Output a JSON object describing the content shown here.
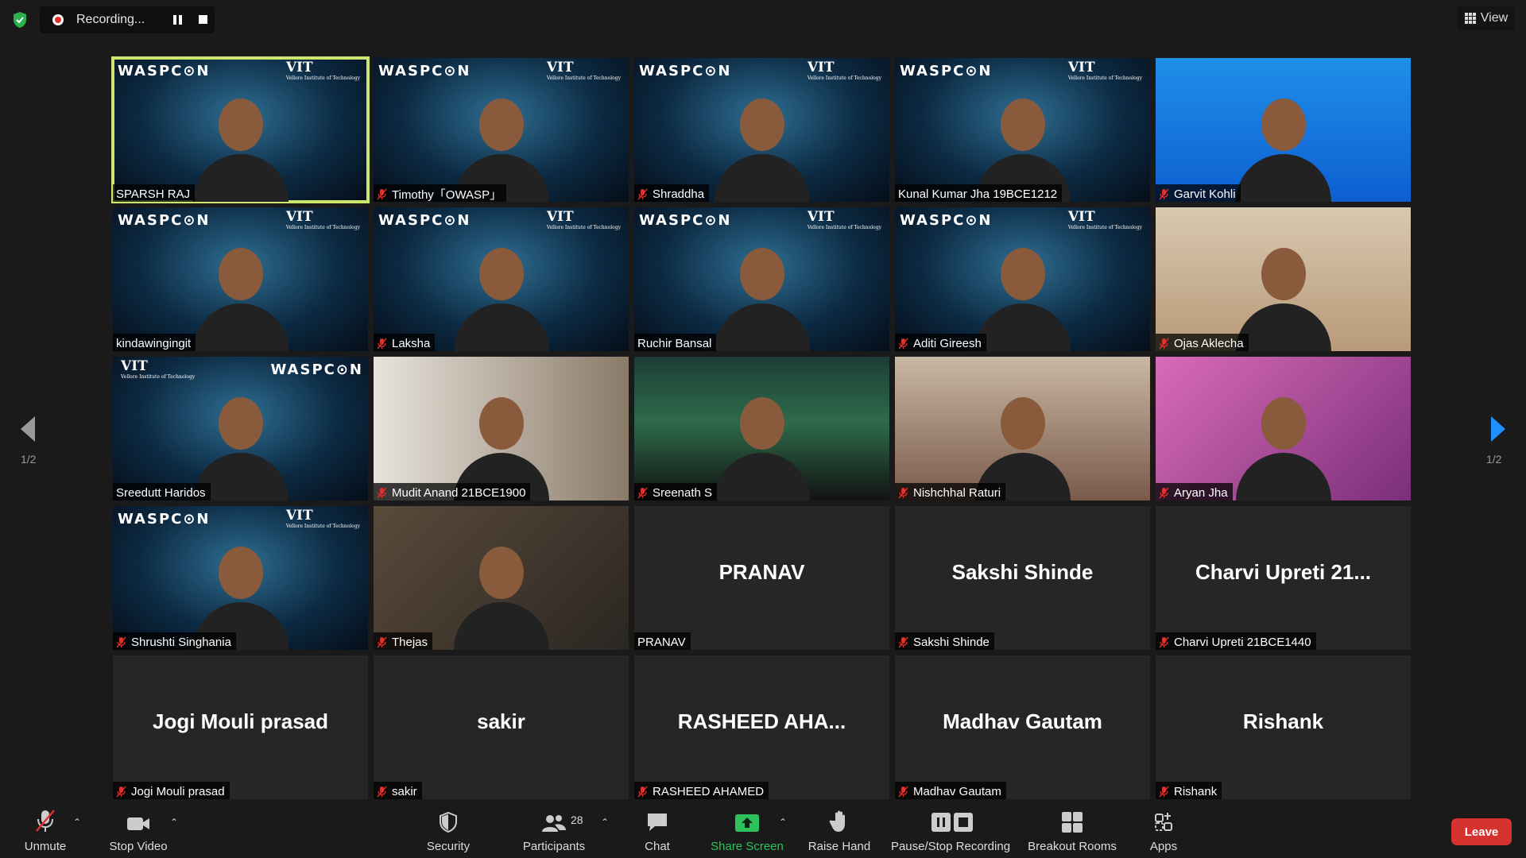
{
  "topbar": {
    "recording_label": "Recording...",
    "view_label": "View"
  },
  "gallery": {
    "page_left": "1/2",
    "page_right": "1/2"
  },
  "participants": [
    {
      "name": "SPARSH RAJ",
      "video": true,
      "muted": false,
      "active": true,
      "bg": "waspcon"
    },
    {
      "name": "Timothy「OWASP」",
      "video": true,
      "muted": true,
      "bg": "waspcon"
    },
    {
      "name": "Shraddha",
      "video": true,
      "muted": true,
      "bg": "waspcon"
    },
    {
      "name": "Kunal Kumar Jha 19BCE1212",
      "video": true,
      "muted": false,
      "bg": "waspcon"
    },
    {
      "name": "Garvit Kohli",
      "video": true,
      "muted": true,
      "bg": "blue"
    },
    {
      "name": "kindawingingit",
      "video": true,
      "muted": false,
      "bg": "waspcon"
    },
    {
      "name": "Laksha",
      "video": true,
      "muted": true,
      "bg": "waspcon"
    },
    {
      "name": "Ruchir Bansal",
      "video": true,
      "muted": false,
      "bg": "waspcon"
    },
    {
      "name": "Aditi Gireesh",
      "video": true,
      "muted": true,
      "bg": "waspcon"
    },
    {
      "name": "Ojas Aklecha",
      "video": true,
      "muted": true,
      "bg": "doge"
    },
    {
      "name": "Sreedutt Haridos",
      "video": true,
      "muted": false,
      "bg": "waspcon-mirrored"
    },
    {
      "name": "Mudit Anand 21BCE1900",
      "video": true,
      "muted": true,
      "bg": "light"
    },
    {
      "name": "Sreenath S",
      "video": true,
      "muted": true,
      "bg": "aurora"
    },
    {
      "name": "Nishchhal Raturi",
      "video": true,
      "muted": true,
      "bg": "room"
    },
    {
      "name": "Aryan Jha",
      "video": true,
      "muted": true,
      "bg": "pink"
    },
    {
      "name": "Shrushti Singhania",
      "video": true,
      "muted": true,
      "bg": "waspcon"
    },
    {
      "name": "Thejas",
      "video": true,
      "muted": true,
      "bg": "plain"
    },
    {
      "name": "PRANAV",
      "video": false,
      "muted": false,
      "display": "PRANAV"
    },
    {
      "name": "Sakshi Shinde",
      "video": false,
      "muted": true,
      "display": "Sakshi Shinde"
    },
    {
      "name": "Charvi Upreti 21BCE1440",
      "video": false,
      "muted": true,
      "display": "Charvi  Upreti  21..."
    },
    {
      "name": "Jogi Mouli prasad",
      "video": false,
      "muted": true,
      "display": "Jogi Mouli prasad"
    },
    {
      "name": "sakir",
      "video": false,
      "muted": true,
      "display": "sakir"
    },
    {
      "name": "RASHEED AHAMED",
      "video": false,
      "muted": true,
      "display": "RASHEED  AHA..."
    },
    {
      "name": "Madhav Gautam",
      "video": false,
      "muted": true,
      "display": "Madhav Gautam"
    },
    {
      "name": "Rishank",
      "video": false,
      "muted": true,
      "display": "Rishank"
    }
  ],
  "background": {
    "waspcon_text": "WASPC⊙N",
    "vit_text": "VIT",
    "vit_sub": "Vellore Institute of Technology"
  },
  "toolbar": {
    "unmute": "Unmute",
    "stop_video": "Stop Video",
    "security": "Security",
    "participants": "Participants",
    "participants_count": "28",
    "chat": "Chat",
    "share_screen": "Share Screen",
    "raise_hand": "Raise Hand",
    "pause_stop_recording": "Pause/Stop Recording",
    "breakout_rooms": "Breakout Rooms",
    "apps": "Apps",
    "leave": "Leave"
  },
  "colors": {
    "active_speaker": "#cbe66a",
    "share_green": "#30c25a",
    "leave_red": "#d6322f",
    "mute_red": "#e0302c",
    "nav_blue": "#1e90ff"
  }
}
